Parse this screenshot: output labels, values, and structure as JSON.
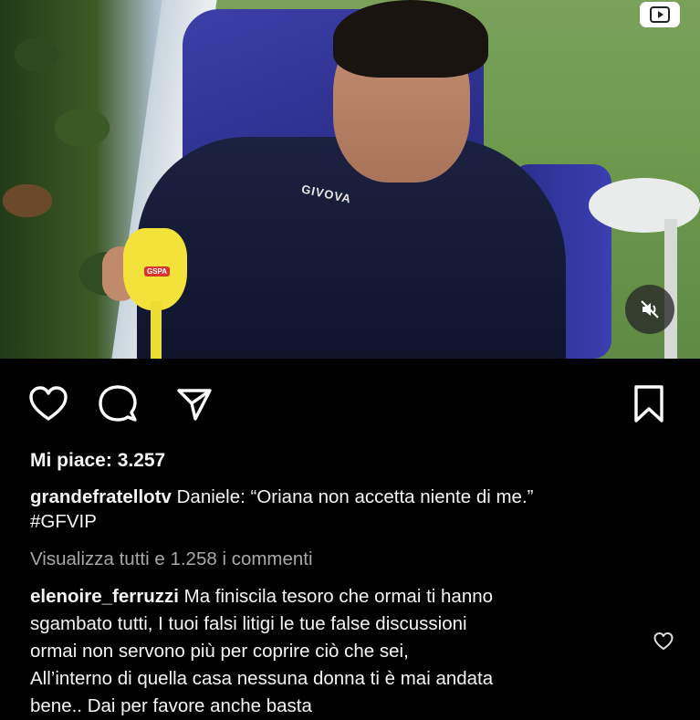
{
  "video": {
    "brand_text": "GIVOVA",
    "cup_logo_text": "GSPA",
    "reel_icon": "play-reel-icon",
    "mute_icon": "speaker-muted-icon"
  },
  "actions": {
    "like_icon": "heart-icon",
    "comment_icon": "comment-bubble-icon",
    "share_icon": "paper-plane-icon",
    "save_icon": "bookmark-icon"
  },
  "post": {
    "likes_text": "Mi piace: 3.257",
    "author": "grandefratellotv",
    "caption_line1": "Daniele: “Oriana non accetta niente di me.”",
    "caption_line2": "#GFVIP",
    "view_comments": "Visualizza tutti e 1.258 i commenti"
  },
  "comment": {
    "author": "elenoire_ferruzzi",
    "line1": "Ma finiscila tesoro che ormai ti hanno",
    "line2": "sgambato tutti, I tuoi falsi litigi le tue false discussioni",
    "line3": "ormai non servono più per coprire ciò che sei,",
    "line4": "All’interno di quella casa nessuna donna ti  è mai andata",
    "line5": "bene.. Dai  per favore anche basta"
  }
}
